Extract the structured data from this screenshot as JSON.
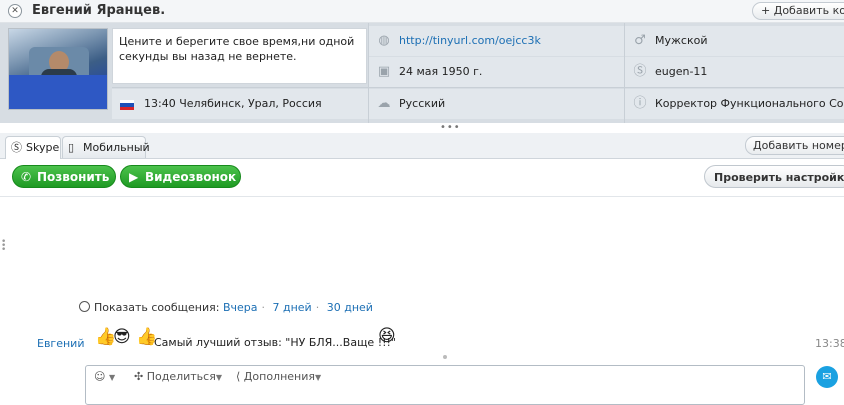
{
  "header": {
    "contact_name": "Евгений Яранцев.",
    "add_contact_label": "Добавить конт"
  },
  "profile": {
    "mood_message": "Цените и берегите свое время,ни одной секунды вы назад не вернете.",
    "homepage": "http://tinyurl.com/oejcc3k",
    "gender": "Мужской",
    "birthday": "24 мая 1950 г.",
    "skype_name": "eugen-11",
    "local_time_location": "13:40 Челябинск, Урал, Россия",
    "language": "Русский",
    "about": "Корректор Функционального Состоя"
  },
  "tabs": [
    {
      "label": "Skype",
      "icon": "skype-icon",
      "active": true
    },
    {
      "label": "Мобильный",
      "icon": "mobile-icon",
      "active": false
    }
  ],
  "add_phone_label": "Добавить номер тел",
  "call_bar": {
    "call_label": "Позвонить",
    "video_label": "Видеозвонок",
    "check_settings_label": "Проверить настройки"
  },
  "history": {
    "label": "Показать сообщения:",
    "options": [
      "Вчера",
      "7 дней",
      "30 дней"
    ]
  },
  "message": {
    "sender": "Евгений",
    "text": "Самый лучший отзыв: \"НУ БЛЯ...Ваще !!!\"",
    "time": "13:38",
    "emoticons": [
      "thumbs-up",
      "cool-face",
      "thumbs-up",
      "laughing-face"
    ]
  },
  "input_toolbar": {
    "emoticon_icon": "smiley-icon",
    "share_label": "Поделиться",
    "extras_label": "Дополнения"
  },
  "colors": {
    "accent_blue": "#1c6fb4",
    "call_green": "#1e9a23",
    "profile_bg": "#d7dde3",
    "send_blue": "#1aa1e1"
  }
}
